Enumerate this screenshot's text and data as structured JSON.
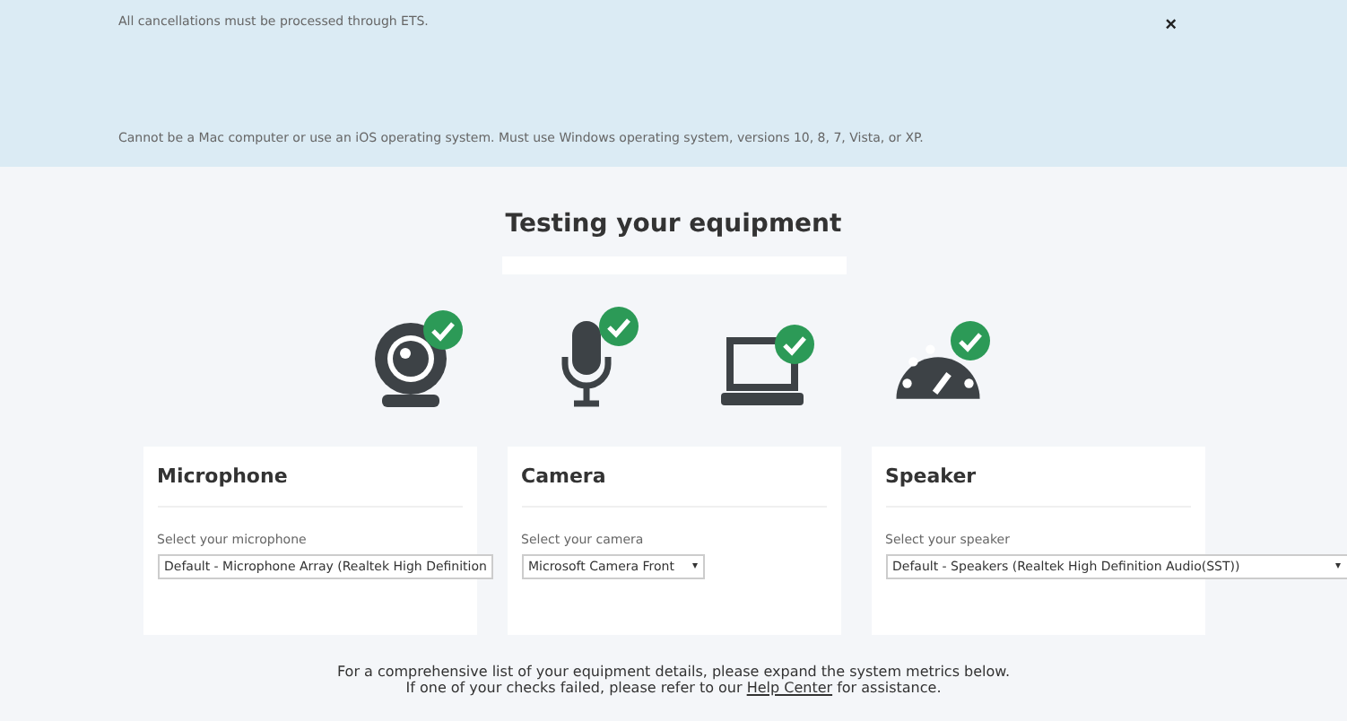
{
  "banner": {
    "messages": [
      "All cancellations must be processed through ETS.",
      "Cannot be a Mac computer or use an iOS operating system. Must use Windows operating system, versions 10, 8, 7, Vista, or XP."
    ],
    "close": "×"
  },
  "title": "Testing your equipment",
  "checks": [
    {
      "kind": "webcam",
      "passed": true
    },
    {
      "kind": "microphone",
      "passed": true
    },
    {
      "kind": "laptop",
      "passed": true
    },
    {
      "kind": "gauge",
      "passed": true
    }
  ],
  "cards": [
    {
      "title": "Microphone",
      "label": "Select your microphone",
      "value": "Default - Microphone Array (Realtek High Definition"
    },
    {
      "title": "Camera",
      "label": "Select your camera",
      "value": "Microsoft Camera Front",
      "caret": "▾"
    },
    {
      "title": "Speaker",
      "label": "Select your speaker",
      "value": "Default - Speakers (Realtek High Definition Audio(SST))",
      "caret": "▾"
    }
  ],
  "footer": {
    "line1": "For a comprehensive list of your equipment details, please expand the system metrics below.",
    "line2_before": "If one of your checks failed, please refer to our",
    "link": "Help Center",
    "line2_after": "for assistance."
  }
}
